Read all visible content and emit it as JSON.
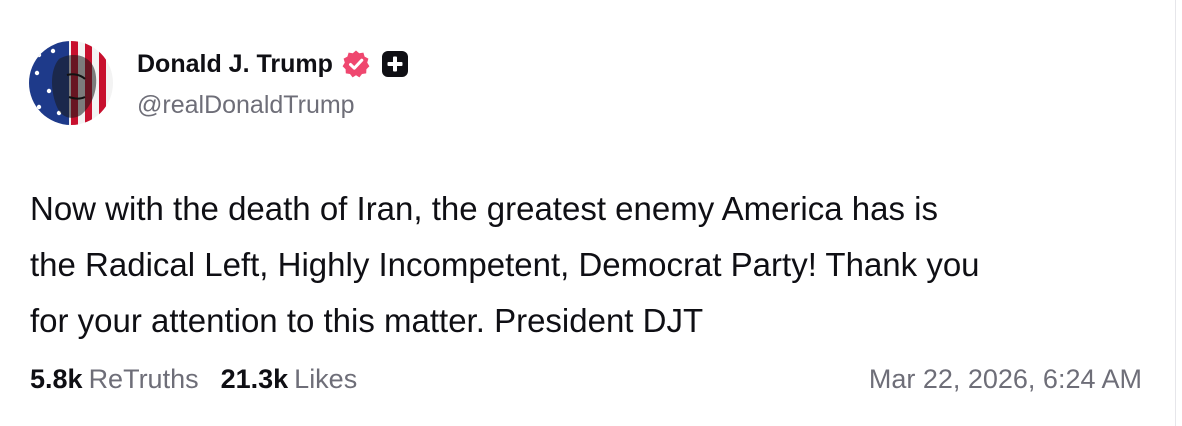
{
  "author": {
    "display_name": "Donald J. Trump",
    "handle": "@realDonaldTrump",
    "verified_badge_icon": "verified-check-icon",
    "plus_badge_icon": "plus-square-icon",
    "badge_color": "#ef476f"
  },
  "post": {
    "line1": "Now with the death of Iran, the greatest enemy America has is",
    "line2": "the Radical Left, Highly Incompetent, Democrat Party! Thank you",
    "line3": "for your attention to this matter. President DJT"
  },
  "stats": {
    "retruths_count": "5.8k",
    "retruths_label": "ReTruths",
    "likes_count": "21.3k",
    "likes_label": "Likes"
  },
  "timestamp": "Mar 22, 2026, 6:24 AM"
}
